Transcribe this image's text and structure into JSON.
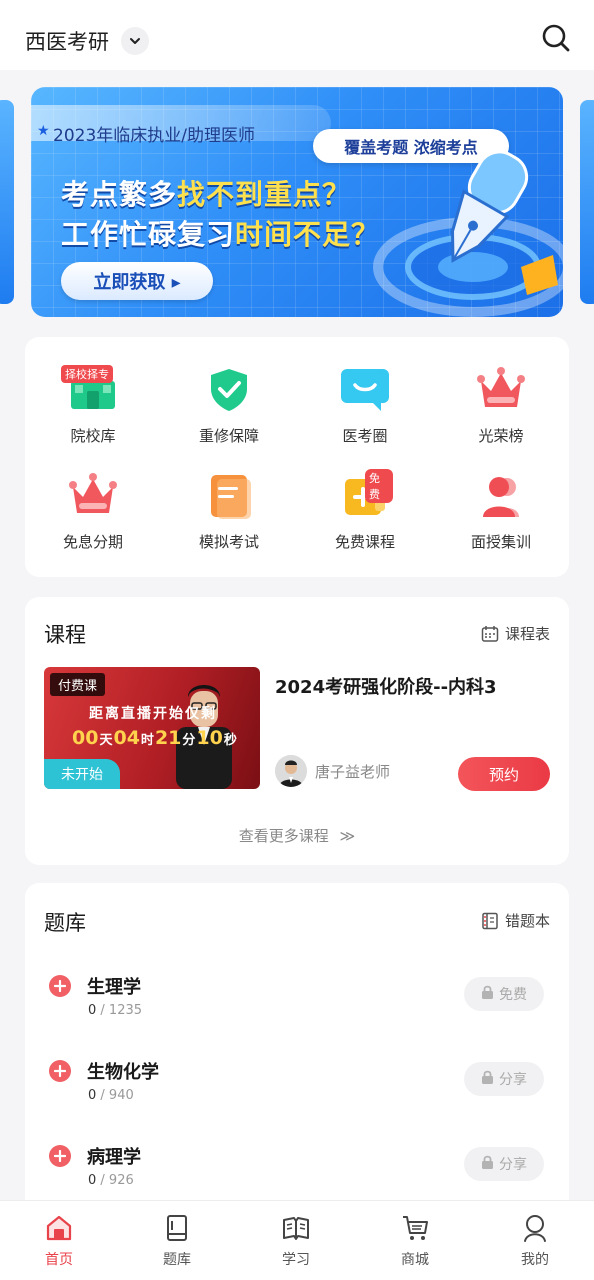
{
  "header": {
    "title": "西医考研"
  },
  "banner": {
    "subtitle": "2023年临床执业/助理医师",
    "tag": "覆盖考题 浓缩考点",
    "line1_a": "考点繁多",
    "line1_b": "找不到重点？",
    "line2_a": "工作忙碌复习",
    "line2_b": "时间不足？",
    "cta": "立即获取 ▸"
  },
  "grid": {
    "items": [
      {
        "label": "院校库",
        "badge": "择校择专"
      },
      {
        "label": "重修保障"
      },
      {
        "label": "医考圈"
      },
      {
        "label": "光荣榜"
      },
      {
        "label": "免息分期"
      },
      {
        "label": "模拟考试"
      },
      {
        "label": "免费课程",
        "badge": "免费"
      },
      {
        "label": "面授集训"
      }
    ]
  },
  "course": {
    "section_title": "课程",
    "schedule_link": "课程表",
    "thumb_badge": "付费课",
    "thumb_status": "未开始",
    "countdown_title": "距离直播开始仅剩",
    "countdown": {
      "days": "00",
      "d_unit": "天",
      "hours": "04",
      "h_unit": "时",
      "minutes": "21",
      "m_unit": "分",
      "seconds": "10",
      "s_unit": "秒"
    },
    "name": "2024考研强化阶段--内科3",
    "teacher": "唐子益老师",
    "book_button": "预约",
    "more": "查看更多课程"
  },
  "qbank": {
    "section_title": "题库",
    "wrong_link": "错题本",
    "rows": [
      {
        "name": "生理学",
        "done": "0",
        "total": " / 1235",
        "action": "免费"
      },
      {
        "name": "生物化学",
        "done": "0",
        "total": " / 940",
        "action": "分享"
      },
      {
        "name": "病理学",
        "done": "0",
        "total": " / 926",
        "action": "分享"
      }
    ]
  },
  "tabbar": {
    "items": [
      {
        "label": "首页"
      },
      {
        "label": "题库"
      },
      {
        "label": "学习"
      },
      {
        "label": "商城"
      },
      {
        "label": "我的"
      }
    ]
  },
  "colors": {
    "accent": "#e8424a",
    "banner_blue": "#2f8ef7"
  }
}
